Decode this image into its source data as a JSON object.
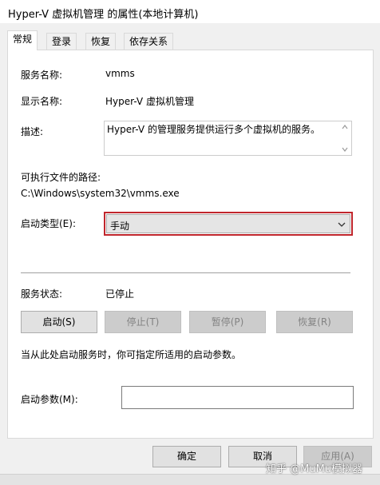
{
  "window": {
    "title": "Hyper-V 虚拟机管理 的属性(本地计算机)"
  },
  "tabs": [
    {
      "label": "常规",
      "active": true
    },
    {
      "label": "登录",
      "active": false
    },
    {
      "label": "恢复",
      "active": false
    },
    {
      "label": "依存关系",
      "active": false
    }
  ],
  "general": {
    "service_name_label": "服务名称:",
    "service_name_value": "vmms",
    "display_name_label": "显示名称:",
    "display_name_value": "Hyper-V 虚拟机管理",
    "description_label": "描述:",
    "description_value": "Hyper-V 的管理服务提供运行多个虚拟机的服务。",
    "path_label": "可执行文件的路径:",
    "path_value": "C:\\Windows\\system32\\vmms.exe",
    "startup_type_label": "启动类型(E):",
    "startup_type_value": "手动",
    "service_status_label": "服务状态:",
    "service_status_value": "已停止",
    "buttons": {
      "start": "启动(S)",
      "stop": "停止(T)",
      "pause": "暂停(P)",
      "resume": "恢复(R)"
    },
    "hint": "当从此处启动服务时，你可指定所适用的启动参数。",
    "start_params_label": "启动参数(M):",
    "start_params_value": ""
  },
  "dialog_buttons": {
    "ok": "确定",
    "cancel": "取消",
    "apply": "应用(A)"
  },
  "watermark": "知乎 @MuMu模拟器",
  "colors": {
    "highlight_border": "#c0262c"
  },
  "icons": [
    "scroll-up-arrow-icon",
    "scroll-down-arrow-icon",
    "dropdown-chevron-icon"
  ]
}
